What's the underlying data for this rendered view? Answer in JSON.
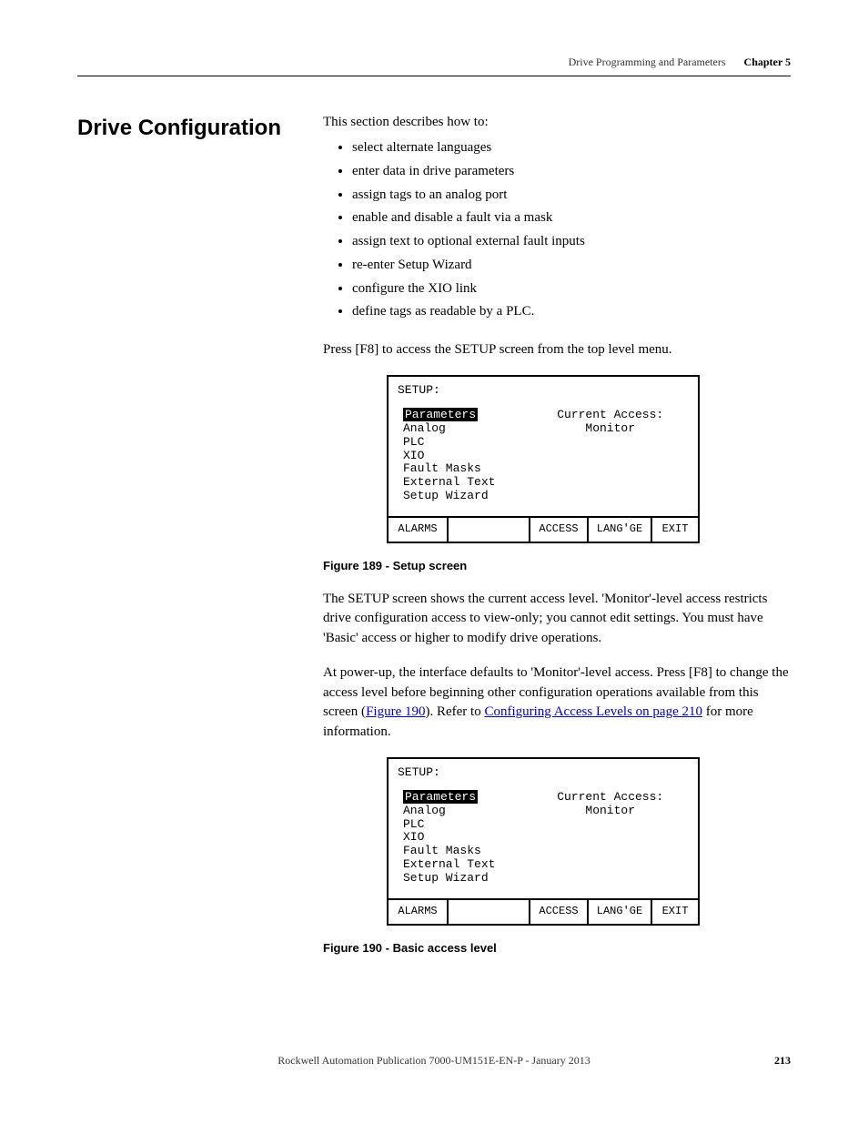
{
  "header": {
    "doc_title": "Drive Programming and Parameters",
    "chapter": "Chapter 5"
  },
  "section_heading": "Drive Configuration",
  "intro": "This section describes how to:",
  "bullets": [
    "select alternate languages",
    "enter data in drive parameters",
    "assign tags to an analog port",
    "enable and disable a fault via a mask",
    "assign text to optional external fault inputs",
    "re-enter Setup Wizard",
    "configure the XIO link",
    "define tags as readable by a PLC."
  ],
  "press_f8": "Press [F8] to access the SETUP screen from the top level menu.",
  "screen": {
    "title": "SETUP:",
    "menu_highlight": "Parameters",
    "menu_rest": "Analog\nPLC\nXIO\nFault Masks\nExternal Text\nSetup Wizard",
    "access_label": "Current Access:",
    "access_value": "Monitor",
    "fn": {
      "c1": "ALARMS",
      "c3": "ACCESS",
      "c4": "LANG'GE",
      "c5": "EXIT"
    }
  },
  "caption1": "Figure 189 - Setup screen",
  "para1": "The SETUP screen shows the current access level. 'Monitor'-level access restricts drive configuration access to view-only; you cannot edit settings. You must have 'Basic' access or higher to modify drive operations.",
  "para2_pre": "At power-up, the interface defaults to 'Monitor'-level access. Press [F8] to change the access level before beginning other configuration operations available from this screen (",
  "para2_link1": "Figure 190",
  "para2_mid": "). Refer to ",
  "para2_link2": "Configuring Access Levels on page 210",
  "para2_post": " for more information.",
  "caption2": "Figure 190 - Basic access level",
  "footer": {
    "pub": "Rockwell Automation Publication 7000-UM151E-EN-P - January 2013",
    "page": "213"
  }
}
